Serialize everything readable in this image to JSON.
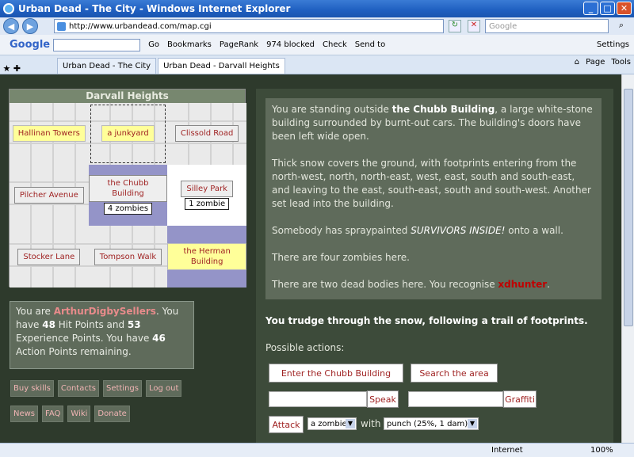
{
  "window": {
    "title": "Urban Dead - The City - Windows Internet Explorer"
  },
  "address": {
    "url": "http://www.urbandead.com/map.cgi",
    "search_placeholder": "Google"
  },
  "google_toolbar": {
    "logo": "Google",
    "items": [
      "Go",
      "Bookmarks",
      "PageRank",
      "974 blocked",
      "Check",
      "Send to"
    ],
    "settings": "Settings"
  },
  "tabs": [
    {
      "label": "Urban Dead - The City"
    },
    {
      "label": "Urban Dead - Darvall Heights"
    }
  ],
  "tab_tools": {
    "page": "Page",
    "tools": "Tools"
  },
  "map": {
    "title": "Darvall Heights",
    "cells": [
      {
        "name": "Hallinan Towers",
        "zombies": ""
      },
      {
        "name": "a junkyard",
        "zombies": ""
      },
      {
        "name": "Clissold Road",
        "zombies": ""
      },
      {
        "name": "Pilcher Avenue",
        "zombies": ""
      },
      {
        "name": "the Chubb Building",
        "zombies": "4 zombies"
      },
      {
        "name": "Silley Park",
        "zombies": "1 zombie"
      },
      {
        "name": "Stocker Lane",
        "zombies": ""
      },
      {
        "name": "Tompson Walk",
        "zombies": ""
      },
      {
        "name": "the Herman Building",
        "zombies": ""
      }
    ]
  },
  "player": {
    "prefix": "You are ",
    "name": "ArthurDigbySellers",
    "t1": ". You have ",
    "hp": "48",
    "t2": " Hit Points and ",
    "xp": "53",
    "t3": " Experience Points. You have ",
    "ap": "46",
    "t4": " Action Points remaining."
  },
  "links_row1": [
    "Buy skills",
    "Contacts",
    "Settings",
    "Log out"
  ],
  "links_row2": [
    "News",
    "FAQ",
    "Wiki",
    "Donate"
  ],
  "description": {
    "p1a": "You are standing outside ",
    "p1b": "the Chubb Building",
    "p1c": ", a large white-stone building surrounded by burnt-out cars. The building's doors have been left wide open.",
    "p2": "Thick snow covers the ground, with footprints entering from the north-west, north, north-east, west, east, south and south-east, and leaving to the east, south-east, south and south-west. Another set lead into the building.",
    "p3a": "Somebody has spraypainted ",
    "p3b": "SURVIVORS INSIDE!",
    "p3c": " onto a wall.",
    "p4": "There are four zombies here.",
    "p5a": "There are two dead bodies here. You recognise ",
    "p5b": "xdhunter",
    "p5c": "."
  },
  "message": "You trudge through the snow, following a trail of footprints.",
  "actions": {
    "label": "Possible actions:",
    "enter": "Enter the Chubb Building",
    "search": "Search the area",
    "speak": "Speak",
    "graffiti": "Graffiti",
    "attack": "Attack",
    "target": "a zombie",
    "with": "with",
    "weapon": "punch (25%, 1 dam)"
  },
  "status": {
    "zone": "Internet",
    "zoom": "100%"
  }
}
